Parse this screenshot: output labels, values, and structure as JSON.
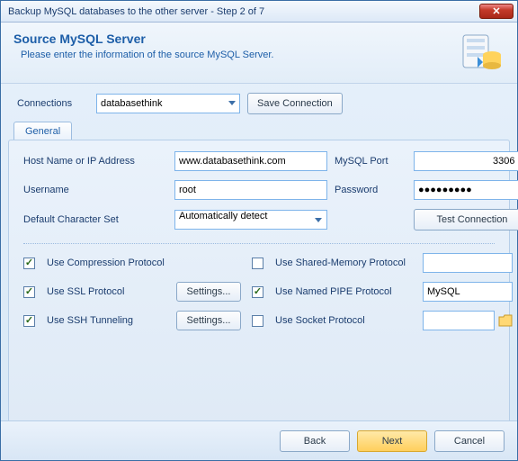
{
  "title": "Backup MySQL databases to the other server - Step 2 of 7",
  "header": {
    "title": "Source MySQL Server",
    "subtitle": "Please enter the information of the source MySQL Server."
  },
  "connections": {
    "label": "Connections",
    "selected": "databasethink",
    "save_button": "Save Connection"
  },
  "tabs": {
    "general": "General"
  },
  "form": {
    "host_label": "Host Name or IP Address",
    "host_value": "www.databasethink.com",
    "port_label": "MySQL Port",
    "port_value": "3306",
    "user_label": "Username",
    "user_value": "root",
    "pass_label": "Password",
    "pass_value": "●●●●●●●●●",
    "charset_label": "Default Character Set",
    "charset_value": "Automatically detect",
    "test_button": "Test Connection"
  },
  "proto": {
    "compression": "Use Compression Protocol",
    "ssl": "Use SSL Protocol",
    "ssh": "Use SSH Tunneling",
    "shared": "Use Shared-Memory Protocol",
    "pipe": "Use Named PIPE Protocol",
    "socket": "Use Socket Protocol",
    "settings": "Settings...",
    "pipe_value": "MySQL"
  },
  "footer": {
    "back": "Back",
    "next": "Next",
    "cancel": "Cancel"
  }
}
